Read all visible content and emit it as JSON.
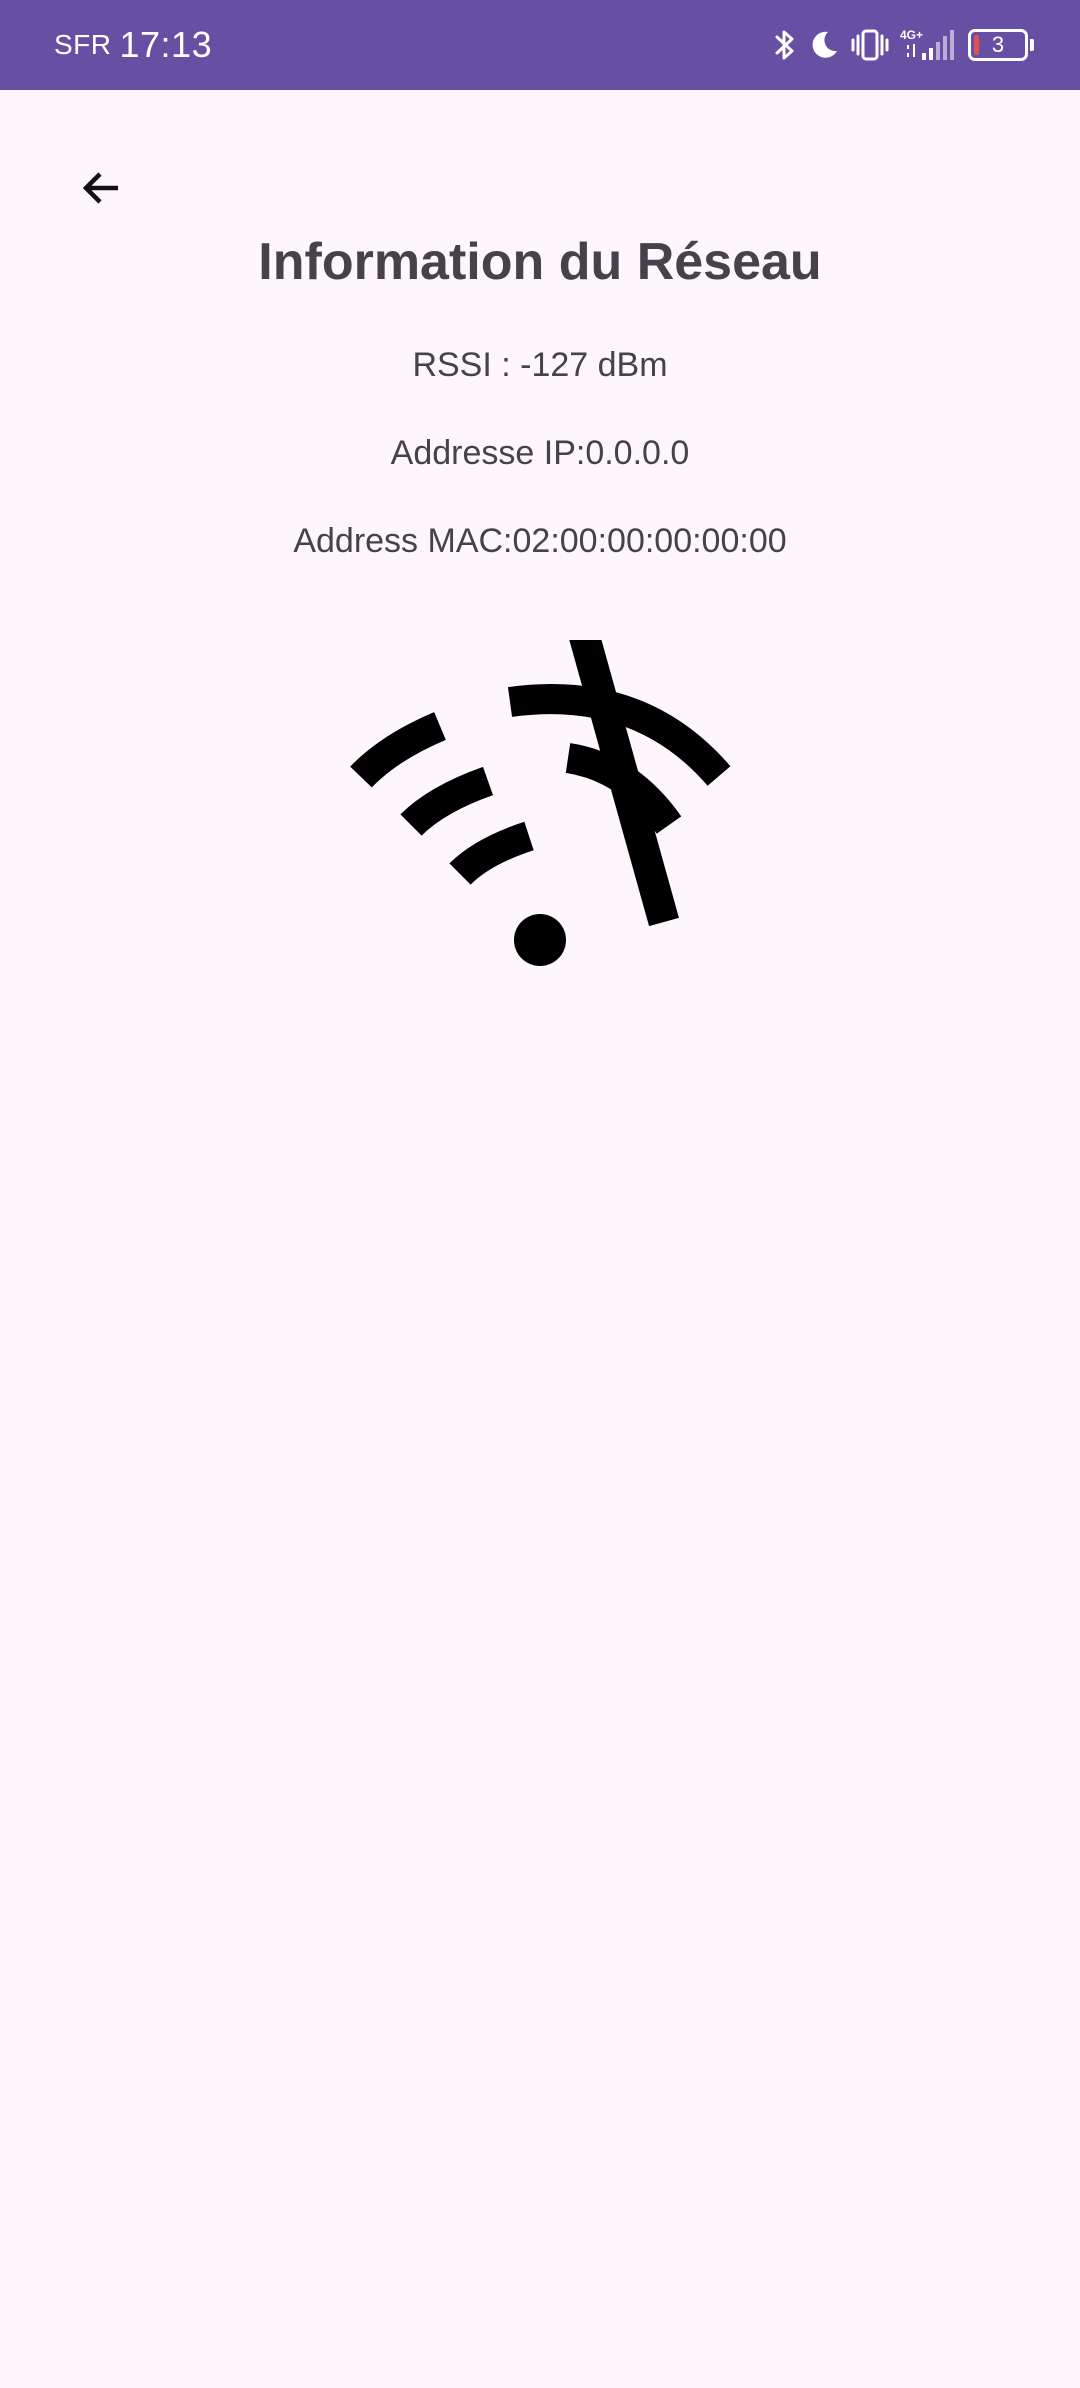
{
  "status_bar": {
    "carrier": "SFR",
    "time": "17:13",
    "network_type": "4G+",
    "battery_level": "3",
    "icons": [
      "bluetooth-icon",
      "moon-icon",
      "vibrate-icon",
      "signal-icon",
      "battery-icon"
    ],
    "background_color": "#674fa3"
  },
  "toolbar": {
    "back_icon": "arrow-back-icon"
  },
  "main": {
    "title": "Information du Réseau",
    "rssi": "RSSI : -127 dBm",
    "ip_address": "Addresse IP:0.0.0.0",
    "mac_address": "Address MAC:02:00:00:00:00:00",
    "status_icon": "wifi-off-icon"
  }
}
